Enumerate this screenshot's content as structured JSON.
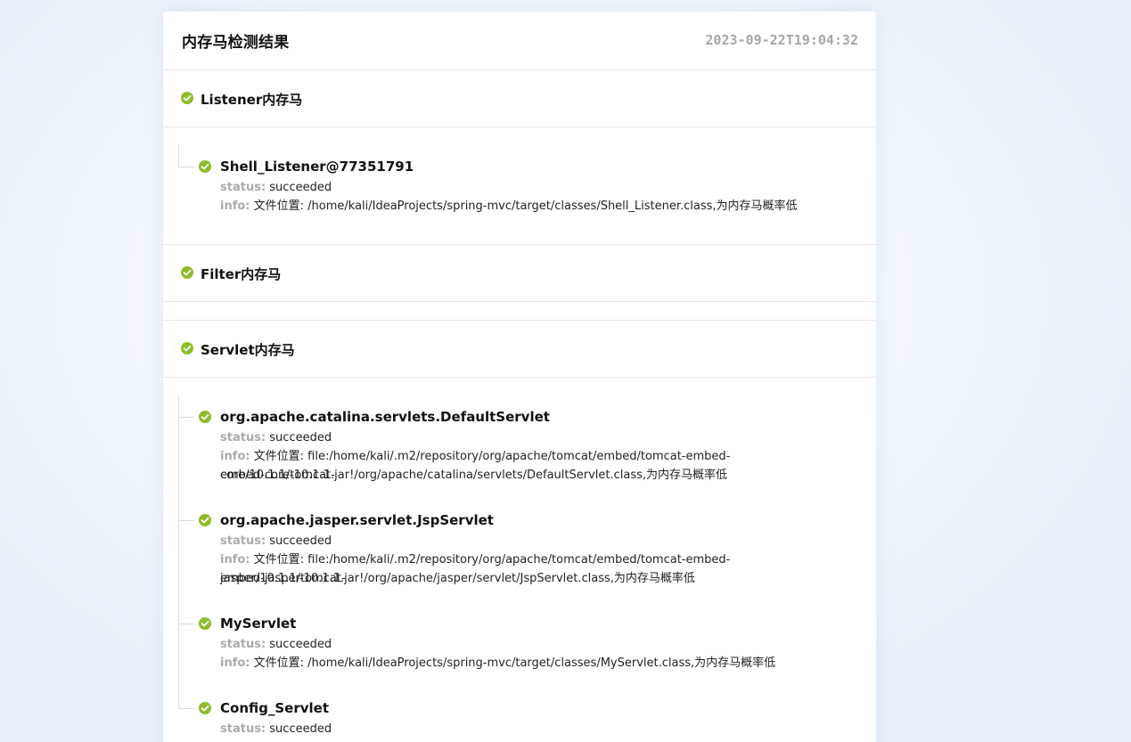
{
  "header": {
    "title": "内存马检测结果",
    "timestamp": "2023-09-22T19:04:32"
  },
  "labels": {
    "status_key": "status:",
    "info_key": "info:"
  },
  "colors": {
    "success": "#8dbd2b",
    "muted": "#aaaaaa"
  },
  "icons": {
    "status": "check-circle-icon"
  },
  "sections": [
    {
      "title": "Listener内存马",
      "items": [
        {
          "name": "Shell_Listener@77351791",
          "status": "succeeded",
          "info": "文件位置: /home/kali/IdeaProjects/spring-mvc/target/classes/Shell_Listener.class,为内存马概率低"
        }
      ]
    },
    {
      "title": "Filter内存马",
      "items": []
    },
    {
      "title": "Servlet内存马",
      "items": [
        {
          "name": "org.apache.catalina.servlets.DefaultServlet",
          "status": "succeeded",
          "info_line1": "文件位置: file:/home/kali/.m2/repository/org/apache/tomcat/embed/tomcat-embed-core/10.1.1/tomcat-",
          "info_line2": "embed-core-10.1.1.jar!/org/apache/catalina/servlets/DefaultServlet.class,为内存马概率低"
        },
        {
          "name": "org.apache.jasper.servlet.JspServlet",
          "status": "succeeded",
          "info_line1": "文件位置: file:/home/kali/.m2/repository/org/apache/tomcat/embed/tomcat-embed-jasper/10.1.1/tomcat-",
          "info_line2": "embed-jasper-10.1.1.jar!/org/apache/jasper/servlet/JspServlet.class,为内存马概率低"
        },
        {
          "name": "MyServlet",
          "status": "succeeded",
          "info": "文件位置: /home/kali/IdeaProjects/spring-mvc/target/classes/MyServlet.class,为内存马概率低"
        },
        {
          "name": "Config_Servlet",
          "status": "succeeded"
        }
      ]
    }
  ]
}
